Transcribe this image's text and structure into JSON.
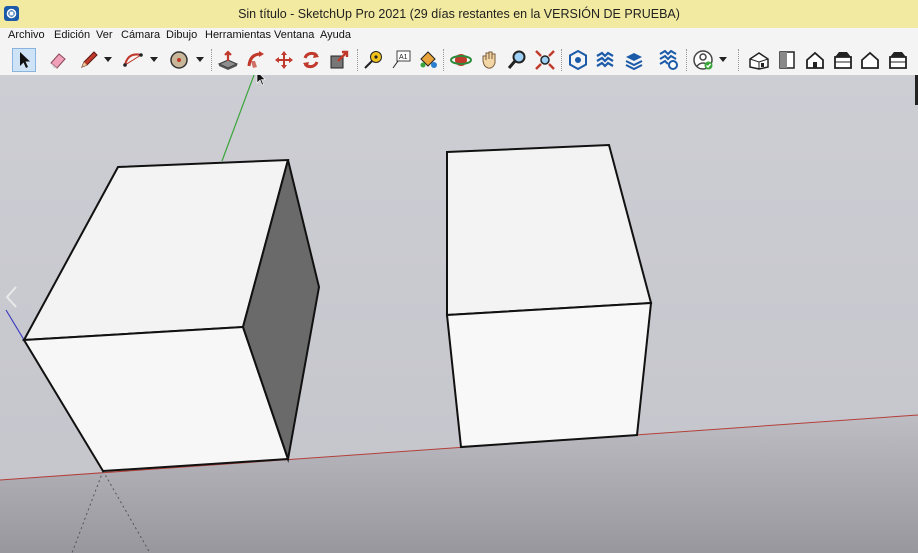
{
  "window": {
    "title": "Sin título - SketchUp Pro 2021 (29 días restantes en la VERSIÓN DE PRUEBA)"
  },
  "menu": [
    "Archivo",
    "Edición",
    "Ver",
    "Cámara",
    "Dibujo",
    "Herramientas",
    "Ventana",
    "Ayuda"
  ],
  "toolbar": {
    "tools": [
      "select-icon",
      "eraser-icon",
      "pencil-icon",
      "arc-icon",
      "shape-circle-icon",
      "push-pull-icon",
      "follow-me-icon",
      "move-icon",
      "rotate-icon",
      "scale-icon",
      "tape-measure-icon",
      "text-icon",
      "paint-bucket-icon",
      "orbit-icon",
      "pan-icon",
      "zoom-icon",
      "zoom-extents-icon",
      "3d-warehouse-icon",
      "extension-warehouse-icon",
      "layout-icon",
      "extension-manager-icon",
      "account-icon",
      "iso-view-icon",
      "top-view-icon",
      "front-view-icon",
      "right-view-icon",
      "back-view-icon",
      "left-view-icon"
    ],
    "selected": "select-icon"
  },
  "colors": {
    "titlebar": "#f2eaa0",
    "sky": "#cdcdd4",
    "ground": "#a7a7ad",
    "green_axis": "#3aa53a",
    "red_axis": "#b3403a",
    "blue_axis": "#3e3ec0",
    "face_light": "#f3f3f3",
    "face_dark": "#6a6a6a"
  }
}
